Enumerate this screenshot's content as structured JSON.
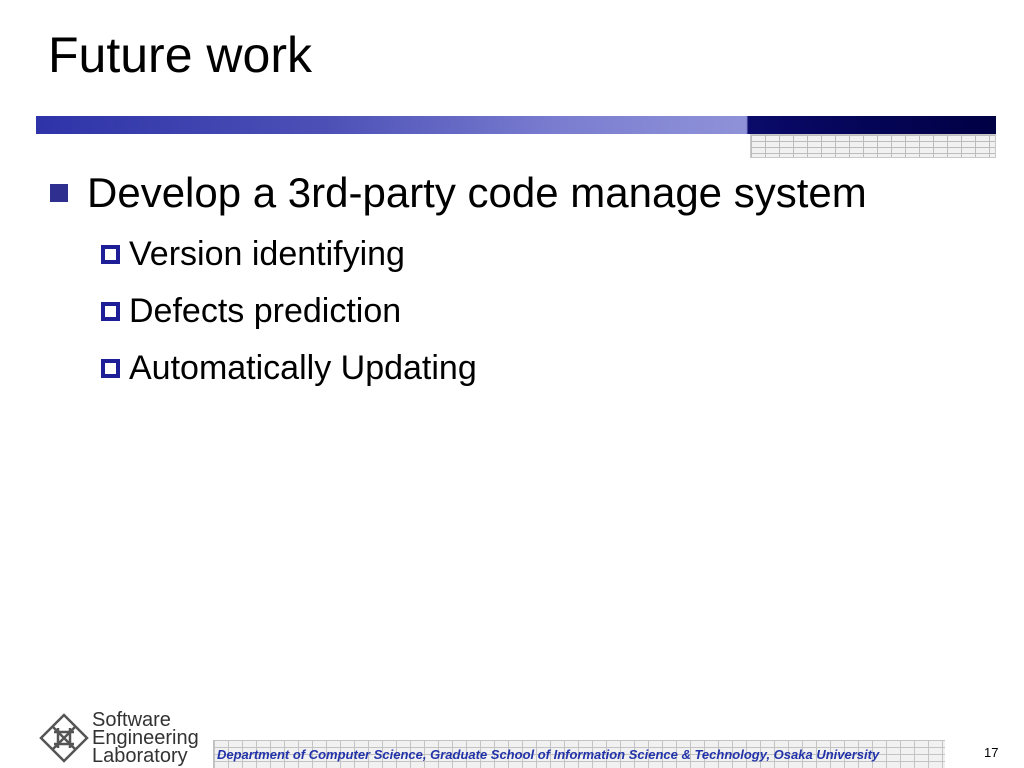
{
  "slide": {
    "title": "Future work",
    "bullets": [
      {
        "text": "Develop a 3rd-party code manage system",
        "sub": [
          "Version identifying",
          "Defects prediction",
          "Automatically Updating"
        ]
      }
    ]
  },
  "footer": {
    "logo_lines": [
      "Software",
      "Engineering",
      "Laboratory"
    ],
    "department": "Department of Computer Science, Graduate School of Information Science & Technology, Osaka University",
    "page_number": "17"
  },
  "colors": {
    "accent": "#2e33a8",
    "bullet": "#2e2f8f",
    "footer_text": "#2233aa"
  },
  "icons": {
    "level1_bullet": "filled-square-icon",
    "level2_bullet": "hollow-square-icon",
    "logo": "lab-logo-icon"
  }
}
